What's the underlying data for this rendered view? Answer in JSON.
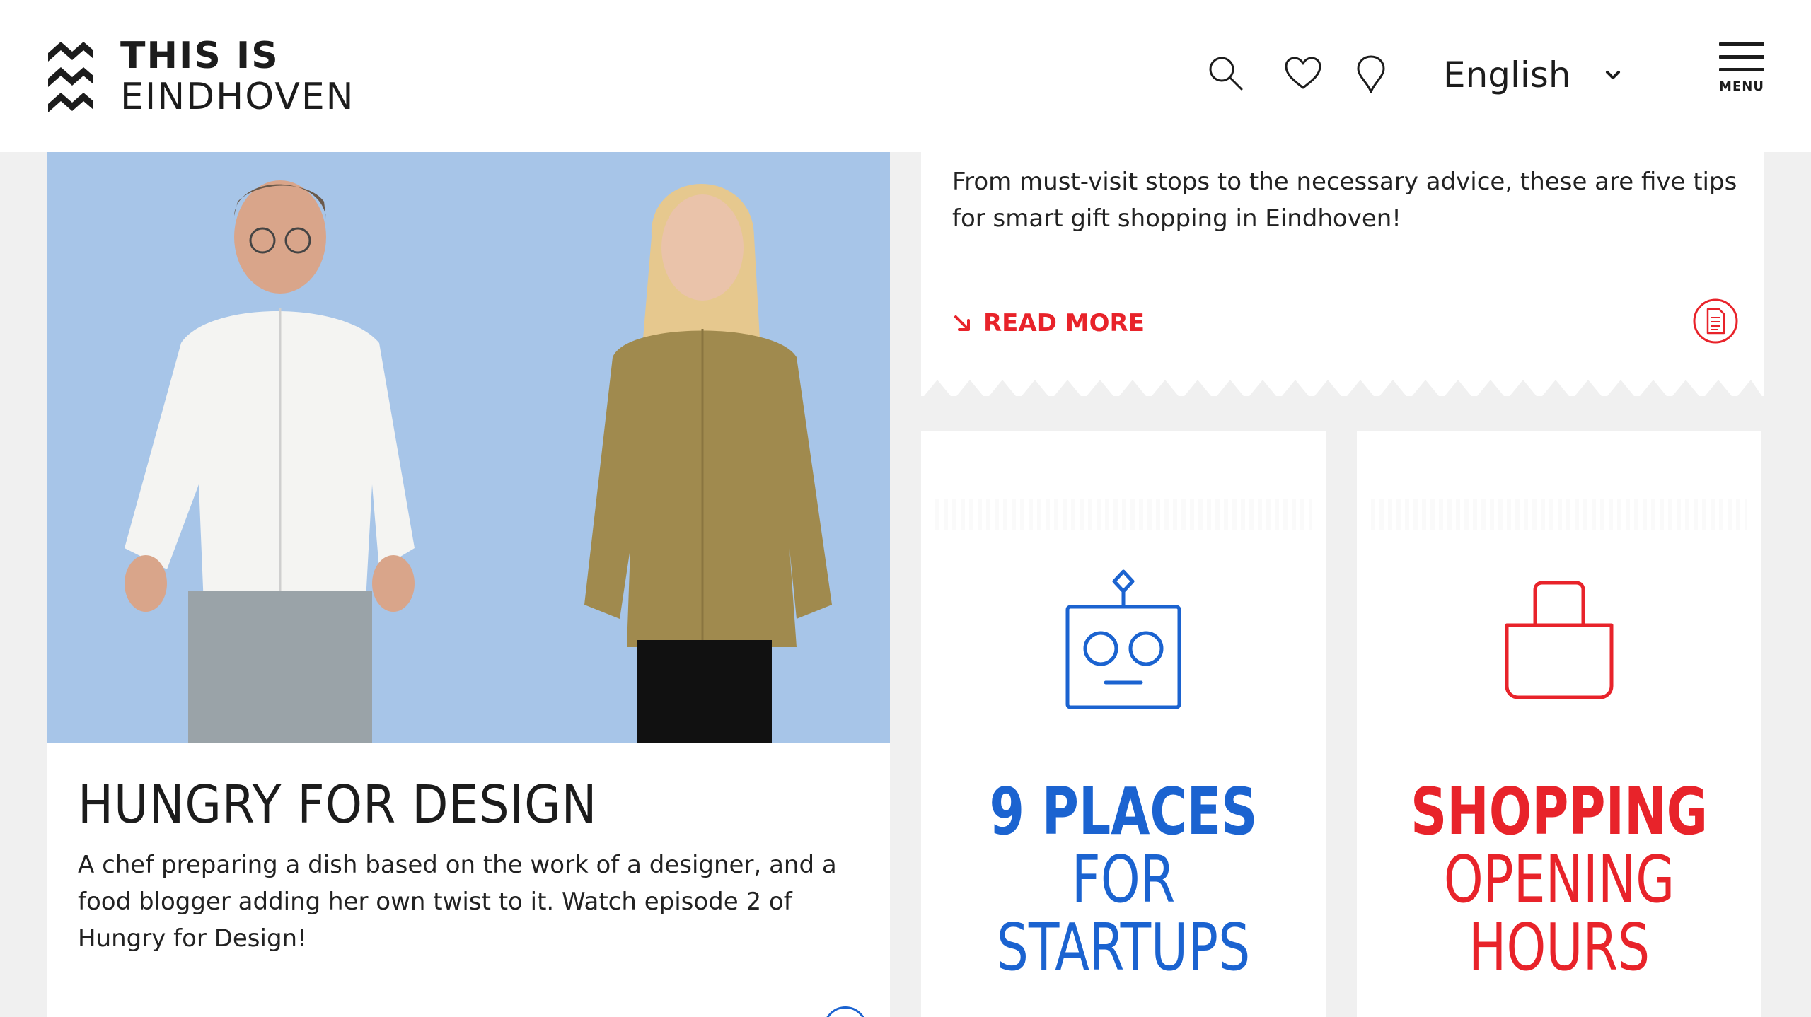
{
  "header": {
    "logo_line1": "THIS IS",
    "logo_line2": "EINDHOVEN",
    "icons": [
      "search-icon",
      "heart-icon",
      "map-pin-icon"
    ],
    "language": "English",
    "menu_label": "MENU"
  },
  "feature_card": {
    "title": "HUNGRY FOR DESIGN",
    "description": "A chef preparing a dish based on the work of a designer, and a food blogger adding her own twist to it. Watch episode 2 of Hungry for Design!"
  },
  "article_card": {
    "excerpt": "From must-visit stops to the necessary advice, these are five tips for smart gift shopping in Eindhoven!",
    "read_more": "READ MORE",
    "type_icon": "document-icon"
  },
  "tiles": [
    {
      "icon": "robot-icon",
      "line1": "9 PLACES",
      "line2": "FOR",
      "line3": "STARTUPS",
      "color": "#1b63d0"
    },
    {
      "icon": "shopping-bag-icon",
      "line1": "SHOPPING",
      "line2": "OPENING",
      "line3": "HOURS",
      "color": "#e8232a"
    }
  ],
  "colors": {
    "accent_red": "#e8232a",
    "accent_blue": "#1b63d0",
    "photo_background": "#a7c5e8",
    "page_background": "#f0f0f0"
  }
}
